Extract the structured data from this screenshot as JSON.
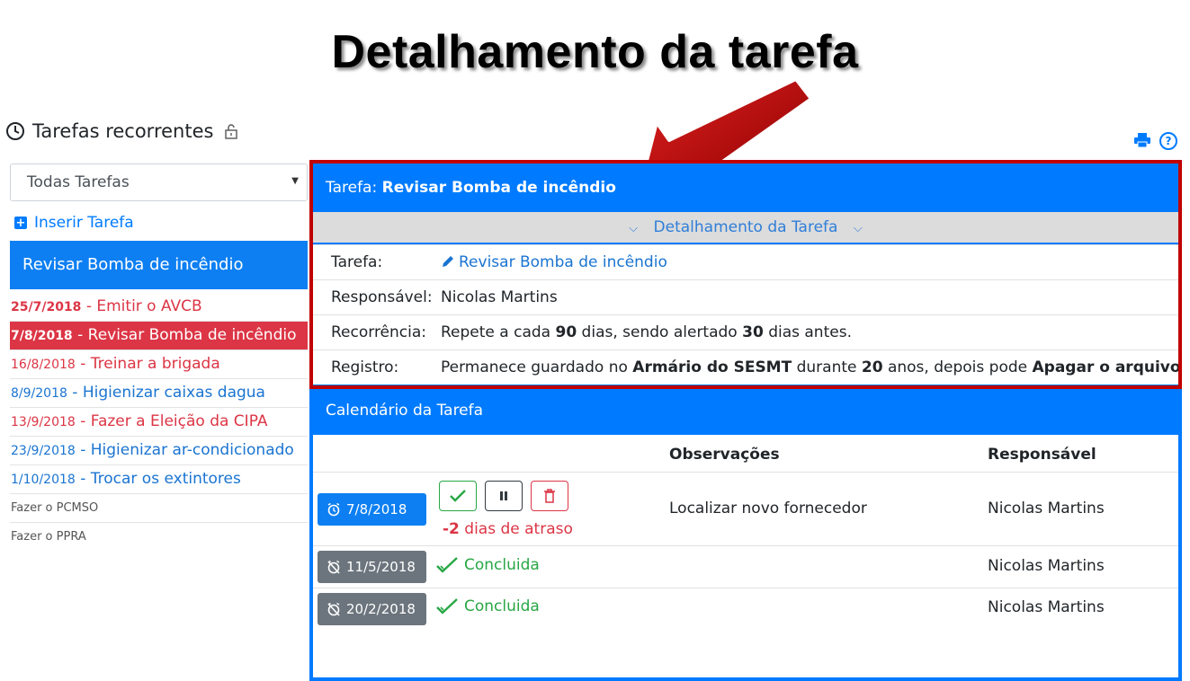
{
  "slide_title": "Detalhamento da tarefa",
  "left_panel": {
    "title": "Tarefas recorrentes",
    "filter_select": "Todas Tarefas",
    "insert_label": "Inserir Tarefa",
    "selected_task": "Revisar Bomba de incêndio",
    "tasks": [
      {
        "date": "25/7/2018",
        "sep": " - ",
        "name": "Emitir o AVCB"
      },
      {
        "date": "7/8/2018",
        "sep": " - ",
        "name": "Revisar Bomba de incêndio"
      },
      {
        "date": "16/8/2018",
        "sep": " - ",
        "name": "Treinar a brigada"
      },
      {
        "date": "8/9/2018",
        "sep": " - ",
        "name": "Higienizar caixas dagua"
      },
      {
        "date": "13/9/2018",
        "sep": " - ",
        "name": "Fazer a Eleição da CIPA"
      },
      {
        "date": "23/9/2018",
        "sep": " - ",
        "name": "Higienizar ar-condicionado"
      },
      {
        "date": "1/10/2018",
        "sep": " - ",
        "name": "Trocar os extintores"
      },
      {
        "name": "Fazer o PCMSO"
      },
      {
        "name": "Fazer o PPRA"
      }
    ]
  },
  "task_header": {
    "prefix": "Tarefa: ",
    "name": "Revisar Bomba de incêndio"
  },
  "details_toggle": "Detalhamento da Tarefa",
  "details": {
    "tarefa_label": "Tarefa:",
    "tarefa_value": "Revisar Bomba de incêndio",
    "responsavel_label": "Responsável:",
    "responsavel_value": "Nicolas Martins",
    "recorrencia_label": "Recorrência:",
    "recorrencia": {
      "t1": "Repete a cada ",
      "days": "90",
      "t2": " dias, sendo alertado ",
      "alert": "30",
      "t3": " dias antes."
    },
    "registro_label": "Registro:",
    "registro": {
      "t1": "Permanece guardado no ",
      "place": "Armário do SESMT",
      "t2": " durante ",
      "years": "20",
      "t3": " anos, depois pode ",
      "action": "Apagar o arquivo"
    }
  },
  "calendar": {
    "title": "Calendário da Tarefa",
    "col_obs": "Observações",
    "col_resp": "Responsável",
    "rows": [
      {
        "date": "7/8/2018",
        "status": "-2",
        "status_suffix": " dias de atraso",
        "obs": "Localizar novo fornecedor",
        "resp": "Nicolas Martins"
      },
      {
        "date": "11/5/2018",
        "status": "Concluida",
        "obs": "",
        "resp": "Nicolas Martins"
      },
      {
        "date": "20/2/2018",
        "status": "Concluida",
        "obs": "",
        "resp": "Nicolas Martins"
      }
    ]
  },
  "colors": {
    "primary": "#007bff",
    "danger": "#dc3545",
    "success": "#28a745",
    "highlight_frame": "#c00000",
    "arrow": "#b30000"
  }
}
